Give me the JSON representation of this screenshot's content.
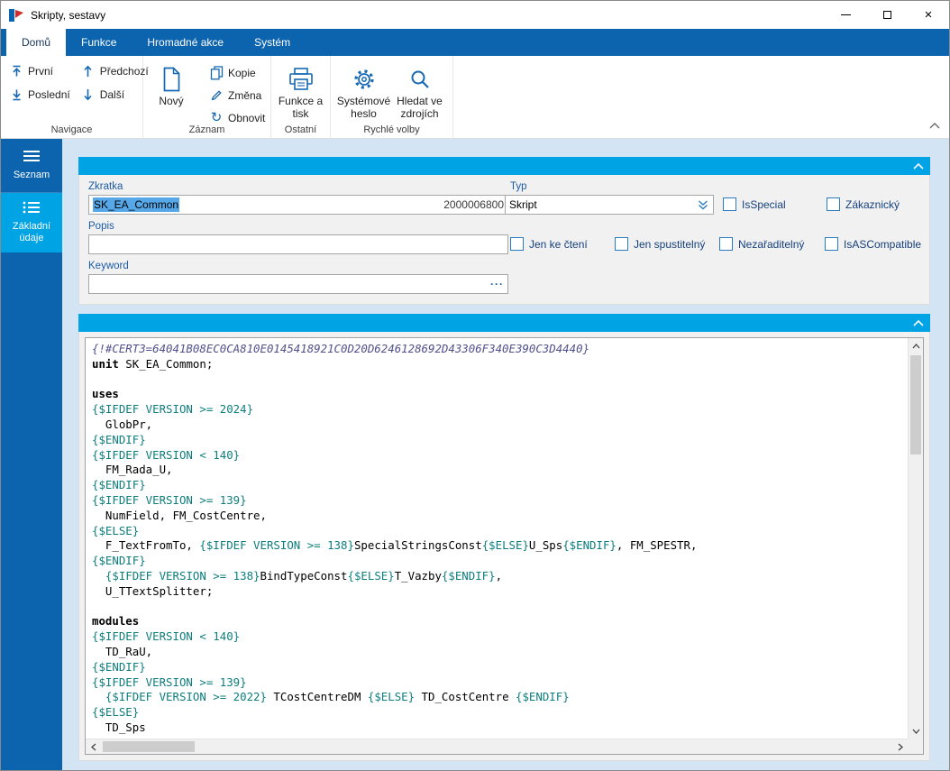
{
  "window": {
    "title": "Skripty, sestavy"
  },
  "ribbon": {
    "tabs": [
      {
        "label": "Domů",
        "active": true
      },
      {
        "label": "Funkce",
        "active": false
      },
      {
        "label": "Hromadné akce",
        "active": false
      },
      {
        "label": "Systém",
        "active": false
      }
    ],
    "groups": [
      {
        "label": "Navigace",
        "small_buttons": [
          {
            "label": "První",
            "icon": "first-record-icon"
          },
          {
            "label": "Poslední",
            "icon": "last-record-icon"
          },
          {
            "label": "Předchozí",
            "icon": "arrow-up-icon"
          },
          {
            "label": "Další",
            "icon": "arrow-down-icon"
          }
        ]
      },
      {
        "label": "Záznam",
        "big_buttons": [
          {
            "label": "Nový",
            "icon": "new-document-icon"
          }
        ],
        "small_buttons": [
          {
            "label": "Kopie",
            "icon": "copy-icon"
          },
          {
            "label": "Změna",
            "icon": "edit-icon"
          },
          {
            "label": "Obnovit",
            "icon": "refresh-icon"
          }
        ]
      },
      {
        "label": "Ostatní",
        "big_buttons": [
          {
            "label": "Funkce a tisk",
            "icon": "printer-icon"
          }
        ]
      },
      {
        "label": "Rychlé volby",
        "big_buttons": [
          {
            "label": "Systémové heslo",
            "icon": "gear-icon"
          },
          {
            "label": "Hledat ve zdrojích",
            "icon": "search-icon"
          }
        ]
      }
    ]
  },
  "sidebar": {
    "items": [
      {
        "label": "Seznam",
        "icon": "menu-icon",
        "active": false
      },
      {
        "label": "Základní údaje",
        "icon": "list-icon",
        "active": true
      }
    ]
  },
  "form": {
    "fields": {
      "zkratka": {
        "label": "Zkratka",
        "value": "SK_EA_Common",
        "id_value": "2000006800"
      },
      "typ": {
        "label": "Typ",
        "value": "Skript"
      },
      "popis": {
        "label": "Popis",
        "value": ""
      },
      "keyword": {
        "label": "Keyword",
        "value": "",
        "browse": "···"
      }
    },
    "checkboxes_row1": [
      {
        "label": "IsSpecial",
        "checked": false
      },
      {
        "label": "Zákaznický",
        "checked": false
      }
    ],
    "checkboxes_row2": [
      {
        "label": "Jen ke čtení",
        "checked": false
      },
      {
        "label": "Jen spustitelný",
        "checked": false
      },
      {
        "label": "Nezařaditelný",
        "checked": false
      },
      {
        "label": "IsASCompatible",
        "checked": false
      }
    ]
  },
  "colors": {
    "ribbon_blue": "#0d64ae",
    "panel_header_cyan": "#00a3e3",
    "sidebar_active": "#00a3e3",
    "icon_accent": "#1668b3",
    "selection": "#57a8e8",
    "code_comment": "#50508c",
    "code_directive": "#0d7d7d",
    "code_keyword": "#000000"
  },
  "editor": {
    "lines": [
      [
        {
          "c": "cm",
          "t": "{!#CERT3=64041B08EC0CA810E0145418921C0D20D6246128692D43306F340E390C3D4440}"
        }
      ],
      [
        {
          "c": "kw",
          "t": "unit"
        },
        {
          "c": "pl",
          "t": " SK_EA_Common;"
        }
      ],
      [],
      [
        {
          "c": "kw",
          "t": "uses"
        }
      ],
      [
        {
          "c": "dir",
          "t": "{$IFDEF VERSION >= 2024}"
        }
      ],
      [
        {
          "c": "pl",
          "t": "  GlobPr,"
        }
      ],
      [
        {
          "c": "dir",
          "t": "{$ENDIF}"
        }
      ],
      [
        {
          "c": "dir",
          "t": "{$IFDEF VERSION < 140}"
        }
      ],
      [
        {
          "c": "pl",
          "t": "  FM_Rada_U,"
        }
      ],
      [
        {
          "c": "dir",
          "t": "{$ENDIF}"
        }
      ],
      [
        {
          "c": "dir",
          "t": "{$IFDEF VERSION >= 139}"
        }
      ],
      [
        {
          "c": "pl",
          "t": "  NumField, FM_CostCentre,"
        }
      ],
      [
        {
          "c": "dir",
          "t": "{$ELSE}"
        }
      ],
      [
        {
          "c": "pl",
          "t": "  F_TextFromTo, "
        },
        {
          "c": "dir",
          "t": "{$IFDEF VERSION >= 138}"
        },
        {
          "c": "pl",
          "t": "SpecialStringsConst"
        },
        {
          "c": "dir",
          "t": "{$ELSE}"
        },
        {
          "c": "pl",
          "t": "U_Sps"
        },
        {
          "c": "dir",
          "t": "{$ENDIF}"
        },
        {
          "c": "pl",
          "t": ", FM_SPESTR,"
        }
      ],
      [
        {
          "c": "dir",
          "t": "{$ENDIF}"
        }
      ],
      [
        {
          "c": "pl",
          "t": "  "
        },
        {
          "c": "dir",
          "t": "{$IFDEF VERSION >= 138}"
        },
        {
          "c": "pl",
          "t": "BindTypeConst"
        },
        {
          "c": "dir",
          "t": "{$ELSE}"
        },
        {
          "c": "pl",
          "t": "T_Vazby"
        },
        {
          "c": "dir",
          "t": "{$ENDIF}"
        },
        {
          "c": "pl",
          "t": ","
        }
      ],
      [
        {
          "c": "pl",
          "t": "  U_TTextSplitter;"
        }
      ],
      [],
      [
        {
          "c": "kw",
          "t": "modules"
        }
      ],
      [
        {
          "c": "dir",
          "t": "{$IFDEF VERSION < 140}"
        }
      ],
      [
        {
          "c": "pl",
          "t": "  TD_RaU,"
        }
      ],
      [
        {
          "c": "dir",
          "t": "{$ENDIF}"
        }
      ],
      [
        {
          "c": "dir",
          "t": "{$IFDEF VERSION >= 139}"
        }
      ],
      [
        {
          "c": "pl",
          "t": "  "
        },
        {
          "c": "dir",
          "t": "{$IFDEF VERSION >= 2022}"
        },
        {
          "c": "pl",
          "t": " TCostCentreDM "
        },
        {
          "c": "dir",
          "t": "{$ELSE}"
        },
        {
          "c": "pl",
          "t": " TD_CostCentre "
        },
        {
          "c": "dir",
          "t": "{$ENDIF}"
        }
      ],
      [
        {
          "c": "dir",
          "t": "{$ELSE}"
        }
      ],
      [
        {
          "c": "pl",
          "t": "  TD_Sps"
        }
      ]
    ]
  }
}
